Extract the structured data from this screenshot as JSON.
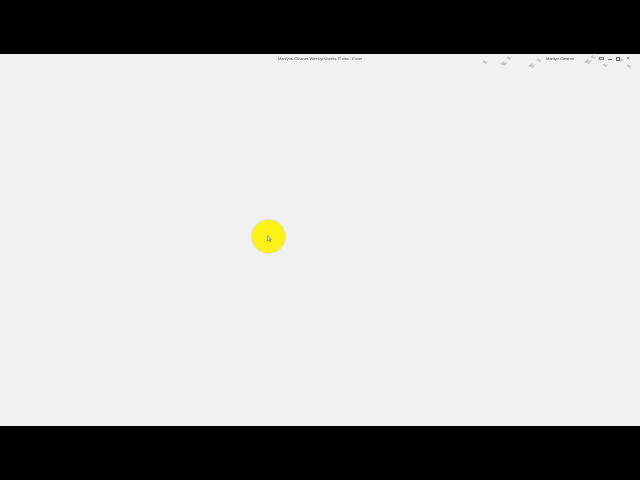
{
  "window": {
    "title": "Marilyns-Cleaner-WeeklyrSheets-IT.xlsx  -  Excel",
    "user_name": "Marilyn Cleaner",
    "close_glyph": "✕"
  },
  "colors": {
    "window_background": "#f1f1f1",
    "letterbox": "#000000",
    "cursor_highlight": "#fbf21a"
  },
  "icons": {
    "ribbon_display": "ribbon-display-options-icon",
    "minimize": "minimize-icon",
    "restore": "restore-icon",
    "close": "close-icon",
    "pointer": "mouse-pointer-icon"
  }
}
